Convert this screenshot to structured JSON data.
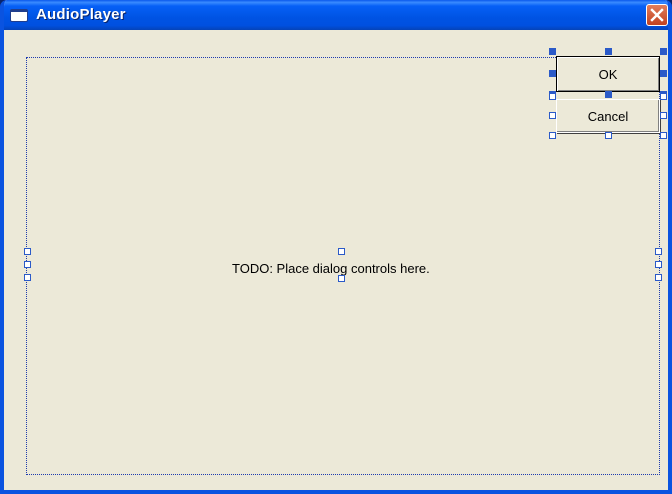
{
  "window": {
    "title": "AudioPlayer",
    "icon": "window-icon",
    "close_icon": "close-icon"
  },
  "dialog": {
    "todo_text": "TODO: Place dialog controls here.",
    "ok_label": "OK",
    "cancel_label": "Cancel"
  },
  "colors": {
    "titlebar": "#0053E3",
    "face": "#ECE9D8",
    "selection": "#2B5AC8",
    "close": "#C2411F"
  }
}
